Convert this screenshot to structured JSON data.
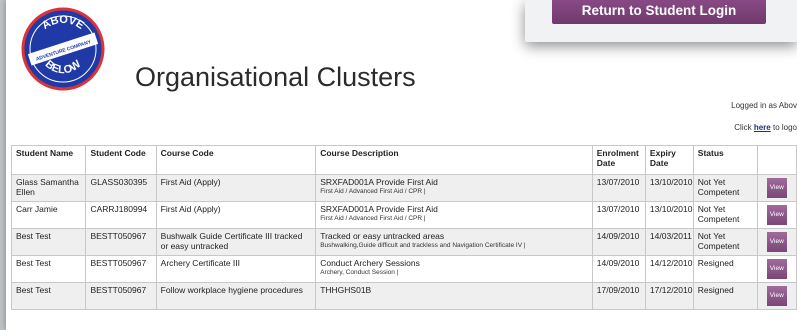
{
  "header": {
    "logo_text_top": "ABOVE",
    "logo_text_mid": "ADVENTURE COMPANY",
    "logo_text_bottom": "BELOW",
    "title": "Organisational Clusters",
    "logged_in_text": "Logged in as Abov",
    "logout_prefix": "Click ",
    "logout_link": "here",
    "logout_suffix": " to logo"
  },
  "overlay": {
    "return_button": "Return to Student Login"
  },
  "table": {
    "columns": [
      "Student Name",
      "Student Code",
      "Course Code",
      "Course Description",
      "Enrolment Date",
      "Expiry Date",
      "Status",
      ""
    ],
    "view_label": "View",
    "rows": [
      {
        "name": "Glass Samantha Ellen",
        "code": "GLASS030395",
        "course_code": "First Aid (Apply)",
        "desc": "SRXFAD001A Provide First Aid",
        "desc_sub": "First Aid / Advanced First Aid / CPR  |",
        "enrolment": "13/07/2010",
        "expiry": "13/10/2010",
        "status": "Not Yet Competent"
      },
      {
        "name": "Carr Jamie",
        "code": "CARRJ180994",
        "course_code": "First Aid (Apply)",
        "desc": "SRXFAD001A Provide First Aid",
        "desc_sub": "First Aid / Advanced First Aid / CPR  |",
        "enrolment": "13/07/2010",
        "expiry": "13/10/2010",
        "status": "Not Yet Competent"
      },
      {
        "name": "Best Test",
        "code": "BESTT050967",
        "course_code": "Bushwalk Guide Certificate III tracked or easy untracked",
        "desc": "Tracked or easy untracked areas",
        "desc_sub": "Bushwalking,Guide difficult and trackless and Navigation Certificate IV  |",
        "enrolment": "14/09/2010",
        "expiry": "14/03/2011",
        "status": "Not Yet Competent"
      },
      {
        "name": "Best Test",
        "code": "BESTT050967",
        "course_code": "Archery Certificate III",
        "desc": "Conduct Archery Sessions",
        "desc_sub": "Archery, Conduct Session  |",
        "enrolment": "14/09/2010",
        "expiry": "14/12/2010",
        "status": "Resigned"
      },
      {
        "name": "Best Test",
        "code": "BESTT050967",
        "course_code": "Follow workplace hygiene procedures",
        "desc": "THHGHS01B",
        "desc_sub": "",
        "enrolment": "17/09/2010",
        "expiry": "17/12/2010",
        "status": "Resigned"
      }
    ]
  },
  "colors": {
    "accent_purple": "#7a4677",
    "logo_blue": "#1f3aa6",
    "logo_red": "#d8343a"
  }
}
